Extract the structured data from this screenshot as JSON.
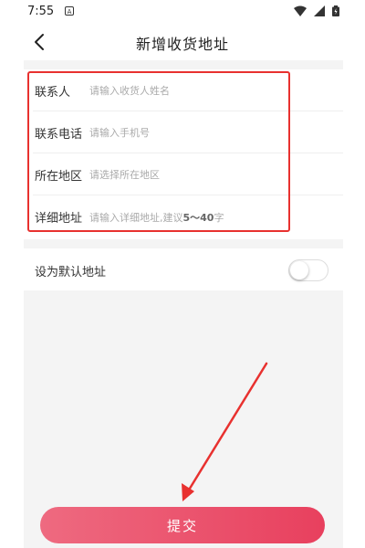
{
  "status_bar": {
    "time": "7:55",
    "notification_icon": "a-square-icon",
    "icons": [
      "wifi-icon",
      "signal-icon",
      "battery-icon"
    ]
  },
  "nav": {
    "title": "新增收货地址",
    "back_icon": "chevron-left-icon"
  },
  "form": {
    "contact_name": {
      "label": "联系人",
      "placeholder": "请输入收货人姓名"
    },
    "phone": {
      "label": "联系电话",
      "placeholder": "请输入手机号"
    },
    "region": {
      "label": "所在地区",
      "placeholder": "请选择所在地区"
    },
    "detail": {
      "label": "详细地址",
      "placeholder_prefix": "请输入详细地址,建议",
      "placeholder_range": "5～40",
      "placeholder_suffix": "字"
    }
  },
  "default_address": {
    "label": "设为默认地址",
    "enabled": false
  },
  "submit": {
    "label": "提交"
  },
  "colors": {
    "annotation_red": "#e8312f",
    "button_gradient_start": "#ee6a80",
    "button_gradient_end": "#e8405e"
  }
}
